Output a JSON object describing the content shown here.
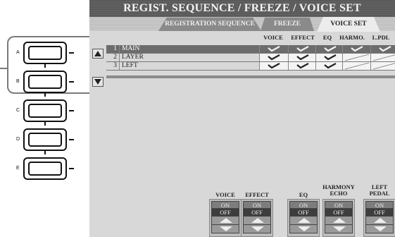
{
  "panel_buttons": [
    "A",
    "B",
    "C",
    "D",
    "E"
  ],
  "title": "REGIST. SEQUENCE / FREEZE / VOICE SET",
  "tabs": [
    {
      "label": "REGISTRATION SEQUENCE",
      "active": false
    },
    {
      "label": "FREEZE",
      "active": false
    },
    {
      "label": "VOICE SET",
      "active": true
    }
  ],
  "columns": [
    "VOICE",
    "EFFECT",
    "EQ",
    "HARMO.",
    "L.PDL"
  ],
  "rows": [
    {
      "num": "1",
      "name": "MAIN",
      "checks": [
        true,
        true,
        true,
        true,
        true
      ],
      "selected": true
    },
    {
      "num": "2",
      "name": "LAYER",
      "checks": [
        true,
        true,
        true,
        false,
        false
      ],
      "selected": false
    },
    {
      "num": "3",
      "name": "LEFT",
      "checks": [
        true,
        true,
        true,
        false,
        false
      ],
      "selected": false
    }
  ],
  "controls": [
    {
      "label": "VOICE",
      "on": "ON",
      "off": "OFF"
    },
    {
      "label": "EFFECT",
      "on": "ON",
      "off": "OFF"
    },
    {
      "label": "EQ",
      "on": "ON",
      "off": "OFF"
    },
    {
      "label": "HARMONY\nECHO",
      "label_line1": "HARMONY",
      "label_line2": "ECHO",
      "on": "ON",
      "off": "OFF"
    },
    {
      "label": "LEFT\nPEDAL",
      "label_line1": "LEFT",
      "label_line2": "PEDAL",
      "on": "ON",
      "off": "OFF"
    }
  ],
  "icons": {
    "scroll_up": "up-arrow-icon",
    "scroll_down": "down-arrow-icon",
    "check": "check-icon"
  },
  "colors": {
    "title_bar": "#5a5a5a",
    "screen_bg": "#d8d8d8",
    "selected_row": "#6c6c6c"
  }
}
